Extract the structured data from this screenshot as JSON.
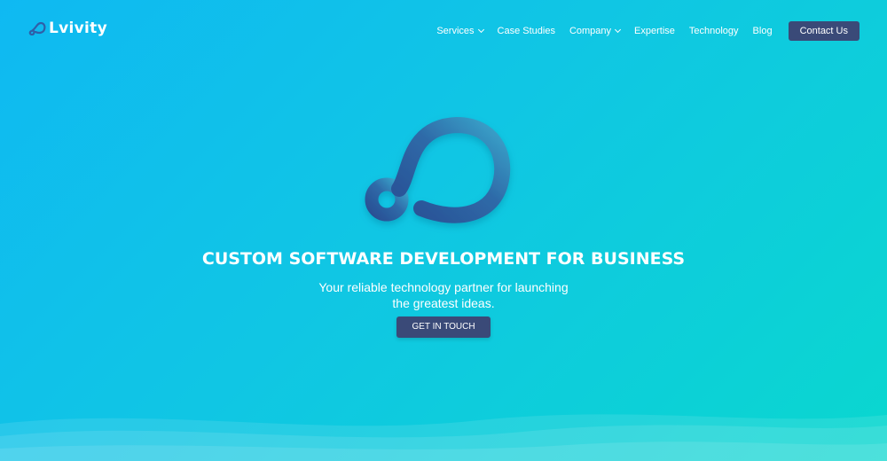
{
  "brand": {
    "name": "Lvivity",
    "logo_icon": "loop-icon"
  },
  "nav": {
    "items": [
      {
        "label": "Services",
        "dropdown": true
      },
      {
        "label": "Case Studies",
        "dropdown": false
      },
      {
        "label": "Company",
        "dropdown": true
      },
      {
        "label": "Expertise",
        "dropdown": false
      },
      {
        "label": "Technology",
        "dropdown": false
      },
      {
        "label": "Blog",
        "dropdown": false
      }
    ],
    "contact_label": "Contact Us"
  },
  "hero": {
    "icon": "loop-icon",
    "title": "CUSTOM SOFTWARE DEVELOPMENT FOR BUSINESS",
    "subtitle_line1": "Your reliable technology partner for launching",
    "subtitle_line2": "the greatest ideas.",
    "cta_label": "GET IN TOUCH"
  },
  "colors": {
    "gradient_start": "#0fb9f2",
    "gradient_end": "#0ad7cf",
    "button": "#3a4a78",
    "icon_dark": "#2e5a9a",
    "icon_light": "#3aa0c8"
  }
}
